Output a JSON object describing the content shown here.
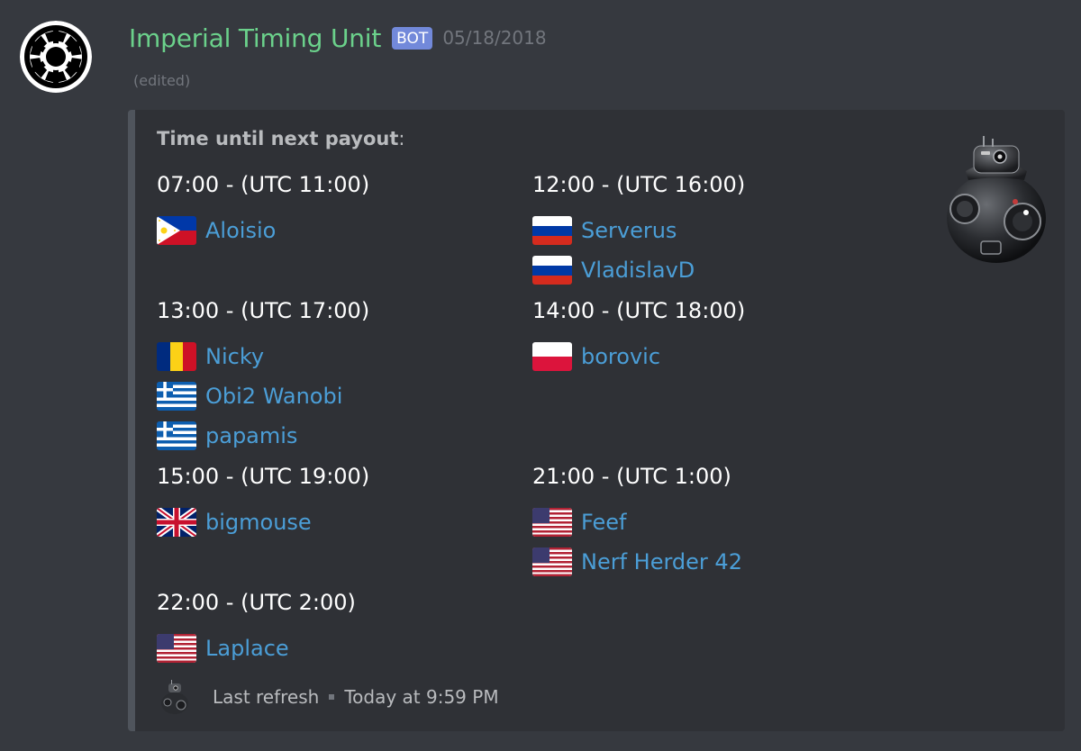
{
  "message": {
    "username": "Imperial Timing Unit",
    "username_color": "#6bd18b",
    "bot_tag": "BOT",
    "timestamp": "05/18/2018",
    "edited": "(edited)",
    "avatar_icon": "imperial-crest-icon"
  },
  "embed": {
    "description_bold": "Time until next payout",
    "description_suffix": ":",
    "thumbnail_icon": "bb9e-droid-icon",
    "fields": [
      {
        "name": "07:00 - (UTC 11:00)",
        "users": [
          {
            "flag": "philippines",
            "name": "Aloisio"
          }
        ]
      },
      {
        "name": "12:00 - (UTC 16:00)",
        "users": [
          {
            "flag": "russia",
            "name": "Serverus"
          },
          {
            "flag": "russia",
            "name": "VladislavD"
          }
        ]
      },
      {
        "name": "13:00 - (UTC 17:00)",
        "users": [
          {
            "flag": "romania",
            "name": "Nicky"
          },
          {
            "flag": "greece",
            "name": "Obi2 Wanobi"
          },
          {
            "flag": "greece",
            "name": "papamis"
          }
        ]
      },
      {
        "name": "14:00 - (UTC 18:00)",
        "users": [
          {
            "flag": "poland",
            "name": "borovic"
          }
        ]
      },
      {
        "name": "15:00 - (UTC 19:00)",
        "users": [
          {
            "flag": "united-kingdom",
            "name": "bigmouse"
          }
        ]
      },
      {
        "name": "21:00 - (UTC 1:00)",
        "users": [
          {
            "flag": "united-states",
            "name": "Feef"
          },
          {
            "flag": "united-states",
            "name": "Nerf Herder 42"
          }
        ]
      },
      {
        "name": "22:00 - (UTC 2:00)",
        "users": [
          {
            "flag": "united-states",
            "name": "Laplace"
          }
        ]
      }
    ],
    "footer": {
      "icon": "bb9e-droid-icon",
      "text": "Last refresh",
      "timestamp": "Today at 9:59 PM"
    }
  },
  "colors": {
    "background": "#36393f",
    "embed_background": "#2f3136",
    "embed_border": "#4f545c",
    "link": "#4b9ed7",
    "bot_tag": "#7289da"
  }
}
